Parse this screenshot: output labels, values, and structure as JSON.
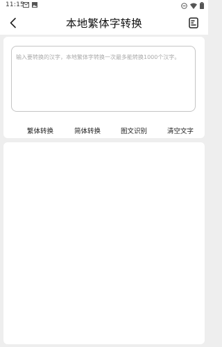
{
  "status_bar": {
    "time": "11:15",
    "icons": [
      "mail-icon",
      "image-icon",
      "minus-circle-icon",
      "wifi-icon",
      "battery-icon"
    ]
  },
  "header": {
    "title": "本地繁体字转换",
    "back_icon": "chevron-left-icon",
    "history_icon": "list-document-icon"
  },
  "input": {
    "value": "",
    "placeholder": "输入要转换的汉字，本地繁体字转换一次最多能转换1000个汉字。"
  },
  "actions": {
    "traditional": "繁体转换",
    "simplified": "简体转换",
    "ocr": "图文识别",
    "clear": "清空文字"
  },
  "result": {
    "text": ""
  }
}
